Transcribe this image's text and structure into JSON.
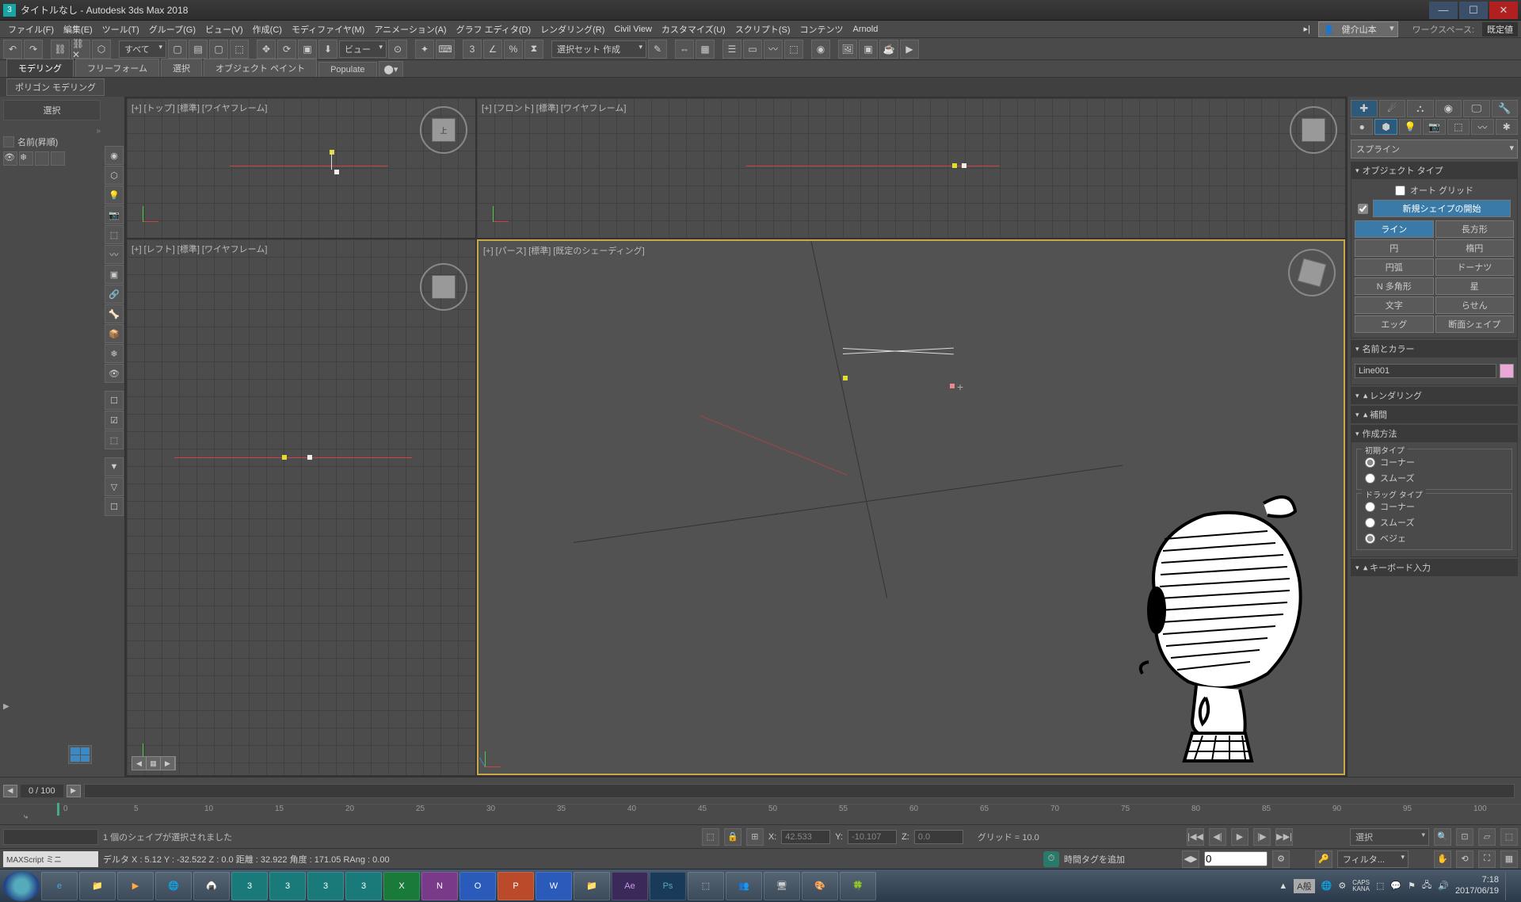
{
  "title": "タイトルなし - Autodesk 3ds Max 2018",
  "menus": [
    "ファイル(F)",
    "編集(E)",
    "ツール(T)",
    "グループ(G)",
    "ビュー(V)",
    "作成(C)",
    "モディファイヤ(M)",
    "アニメーション(A)",
    "グラフ エディタ(D)",
    "レンダリング(R)",
    "Civil View",
    "カスタマイズ(U)",
    "スクリプト(S)",
    "コンテンツ",
    "Arnold"
  ],
  "user": "健介山本",
  "workspace_label": "ワークスペース:",
  "workspace_value": "既定値",
  "toolbar_all": "すべて",
  "toolbar_view": "ビュー",
  "toolbar_selset": "選択セット 作成",
  "ribbon_tabs": [
    "モデリング",
    "フリーフォーム",
    "選択",
    "オブジェクト ペイント",
    "Populate"
  ],
  "ribbon_sub": "ポリゴン モデリング",
  "left_panel": {
    "select": "選択",
    "name": "名前(昇順)"
  },
  "viewports": {
    "top": "[+] [トップ] [標準] [ワイヤフレーム]",
    "front": "[+] [フロント] [標準] [ワイヤフレーム]",
    "left": "[+] [レフト] [標準] [ワイヤフレーム]",
    "persp": "[+] [パース] [標準] [既定のシェーディング]",
    "cube_top": "上"
  },
  "command_panel": {
    "dropdown": "スプライン",
    "rollout_objtype": "オブジェクト タイプ",
    "autogrid": "オート グリッド",
    "newshape": "新規シェイプの開始",
    "buttons": [
      [
        "ライン",
        "長方形"
      ],
      [
        "円",
        "楕円"
      ],
      [
        "円弧",
        "ドーナツ"
      ],
      [
        "N 多角形",
        "星"
      ],
      [
        "文字",
        "らせん"
      ],
      [
        "エッグ",
        "断面シェイプ"
      ]
    ],
    "rollout_name": "名前とカラー",
    "object_name": "Line001",
    "rollout_render": "レンダリング",
    "rollout_interp": "補間",
    "rollout_creation": "作成方法",
    "init_type": "初期タイプ",
    "drag_type": "ドラッグ タイプ",
    "corner": "コーナー",
    "smooth": "スムーズ",
    "bezier": "ベジェ",
    "rollout_keyboard": "キーボード入力"
  },
  "timeline": {
    "frame_range": "0 / 100",
    "ticks": [
      0,
      5,
      10,
      15,
      20,
      25,
      30,
      35,
      40,
      45,
      50,
      55,
      60,
      65,
      70,
      75,
      80,
      85,
      90,
      95,
      100
    ]
  },
  "status": {
    "shapes_selected": "1 個のシェイプが選択されました",
    "delta": "デルタ X : 5.12  Y : -32.522  Z : 0.0  距離 : 32.922 角度 : 171.05 RAng : 0.00",
    "X_label": "X:",
    "X_val": "42.533",
    "Y_label": "Y:",
    "Y_val": "-10.107",
    "Z_label": "Z:",
    "Z_val": "0.0",
    "grid": "グリッド = 10.0",
    "time_tag": "時間タグを追加",
    "select_mode": "選択",
    "filter": "フィルタ...",
    "maxscript": "MAXScript ミニ",
    "frame_input": "0"
  },
  "ime": "A般",
  "caps": "CAPS",
  "kana": "KANA",
  "taskbar": {
    "time": "7:18",
    "date": "2017/06/19"
  }
}
